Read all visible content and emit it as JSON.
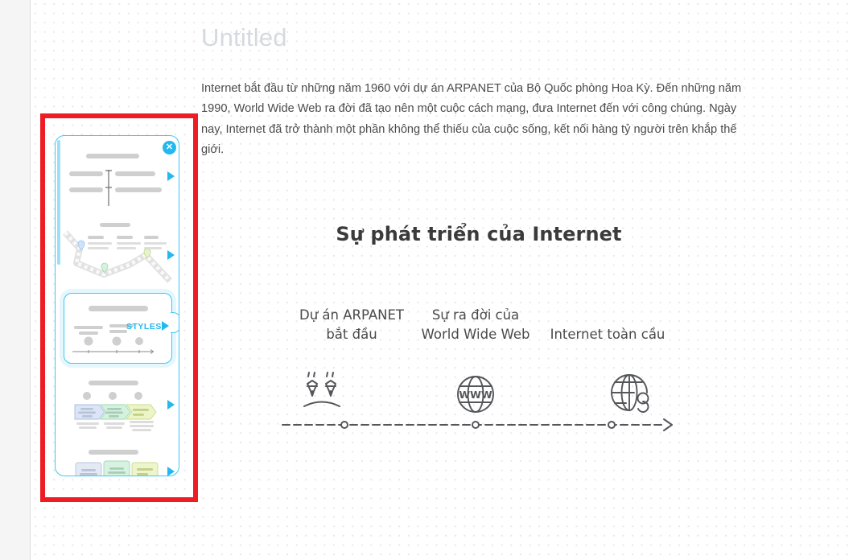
{
  "document": {
    "title": "Untitled",
    "paragraph": "Internet bắt đầu từ những năm 1960 với dự án ARPANET của Bộ Quốc phòng Hoa Kỳ. Đến những năm 1990, World Wide Web ra đời đã tạo nên một cuộc cách mạng, đưa Internet đến với công chúng. Ngày nay, Internet đã trở thành một phần không thể thiếu của cuộc sống, kết nối hàng tỷ người trên khắp thế giới."
  },
  "diagram": {
    "title": "Sự phát triển của Internet",
    "milestones": [
      {
        "label": "Dự án ARPANET bắt đầu",
        "icon": "satellite-nodes-icon"
      },
      {
        "label": "Sự ra đời của World Wide Web",
        "icon": "www-globe-icon"
      },
      {
        "label": "Internet toàn cầu",
        "icon": "global-network-globe-icon"
      }
    ]
  },
  "chart_data": {
    "type": "timeline",
    "title": "Sự phát triển của Internet",
    "orientation": "horizontal",
    "axis_style": "dashed-arrow",
    "categories": [
      "Dự án ARPANET bắt đầu",
      "Sự ra đời của World Wide Web",
      "Internet toàn cầu"
    ],
    "markers": [
      {
        "label": "Dự án ARPANET bắt đầu",
        "x_fraction": 0.155,
        "icon": "satellite-nodes-icon"
      },
      {
        "label": "Sự ra đời của World Wide Web",
        "x_fraction": 0.497,
        "icon": "www-globe-icon"
      },
      {
        "label": "Internet toàn cầu",
        "x_fraction": 0.844,
        "icon": "global-network-globe-icon"
      }
    ],
    "xlabel": "",
    "ylabel": "",
    "grid": false,
    "legend": "none"
  },
  "templates_panel": {
    "close_label": "✕",
    "styles_label": "STYLES",
    "items": [
      {
        "name": "central-axis-layout",
        "selected": false,
        "expand_label": "▶"
      },
      {
        "name": "winding-road-layout",
        "selected": false,
        "expand_label": "▶"
      },
      {
        "name": "milestone-timeline-layout",
        "selected": true,
        "expand_label": "▶"
      },
      {
        "name": "chevron-process-layout",
        "selected": false,
        "expand_label": "▶"
      },
      {
        "name": "card-stack-layout",
        "selected": false,
        "expand_label": "▶"
      }
    ]
  },
  "annotation": {
    "highlight_color": "#ee1c24",
    "accent_color": "#23b9ee"
  }
}
